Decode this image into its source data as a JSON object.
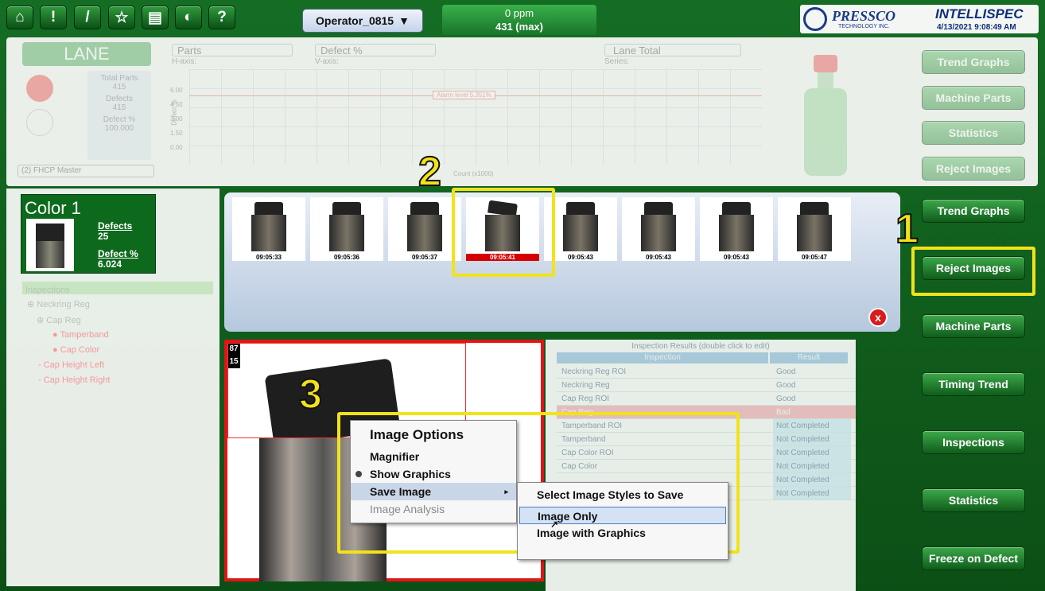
{
  "topbar": {
    "icons": [
      "home-icon",
      "alert-icon",
      "wrench-icon",
      "star-icon",
      "save-icon",
      "globe-icon",
      "help-icon"
    ],
    "home": "⌂",
    "alert": "!",
    "wrench": "/",
    "star": "☆",
    "save": "▤",
    "globe": "◐",
    "help": "?",
    "operator": "Operator_0815",
    "rate": "0 ppm",
    "rate_max": "431 (max)",
    "brand": "PRESSCO",
    "brand_sub": "TECHNOLOGY INC.",
    "product": "INTELLISPEC",
    "datetime": "4/13/2021 9:08:49 AM"
  },
  "lane_panel": {
    "title": "LANE",
    "dropdowns": [
      "Parts",
      "Defect %",
      "Lane Total"
    ],
    "dropdown_captions": [
      "H-axis:",
      "V-axis:",
      "Series:"
    ],
    "stats": [
      {
        "label": "Total Parts",
        "value": "415"
      },
      {
        "label": "Defects",
        "value": "415"
      },
      {
        "label": "Defect %",
        "value": "100.000"
      }
    ],
    "recipe": "(2) FHCP Master",
    "y_ticks": [
      "6.00",
      "4.50",
      "3.00",
      "1.50",
      "0.00"
    ],
    "y_label": "Defect %",
    "x_label": "Count (x1000)",
    "alarm": "Alarm level 5.351%",
    "side_buttons": [
      "Trend Graphs",
      "Machine Parts",
      "Statistics",
      "Reject Images"
    ]
  },
  "color_card": {
    "title": "Color 1",
    "defects_label": "Defects",
    "defects": "25",
    "defect_pct_label": "Defect %",
    "defect_pct": "6.024"
  },
  "tree": {
    "root": "Inspections",
    "items": [
      "⊕ Neckring Reg",
      "⊕ Cap Reg",
      "● Tamperband",
      "● Cap Color",
      "- Cap Height Left",
      "- Cap Height Right"
    ]
  },
  "thumbnails": [
    "09:05:33",
    "09:05:36",
    "09:05:37",
    "09:05:41",
    "09:05:43",
    "09:05:43",
    "09:05:43",
    "09:05:47"
  ],
  "close_icon": "x",
  "image_overlay": {
    "line1": "87",
    "line2": "15"
  },
  "callouts": [
    "1",
    "2",
    "3"
  ],
  "results": {
    "title": "Inspection Results (double click to edit)",
    "headers": [
      "Inspection",
      "Result"
    ],
    "rows": [
      [
        "Neckring Reg ROI",
        "Good"
      ],
      [
        "Neckring Reg",
        "Good"
      ],
      [
        "Cap Reg ROI",
        "Good"
      ],
      [
        "Cap Reg",
        "Bad"
      ],
      [
        "Tamperband ROI",
        "Not Completed"
      ],
      [
        "Tamperband",
        "Not Completed"
      ],
      [
        "Cap Color ROI",
        "Not Completed"
      ],
      [
        "Cap Color",
        "Not Completed"
      ],
      [
        "",
        "Not Completed"
      ],
      [
        "",
        "Not Completed"
      ]
    ]
  },
  "context_menu": {
    "title": "Image Options",
    "items": [
      "Magnifier",
      "Show Graphics",
      "Save Image",
      "Image Analysis"
    ],
    "submenu": [
      "Select Image Styles to Save",
      "Image Only",
      "Image with Graphics"
    ]
  },
  "right_buttons": [
    "Trend Graphs",
    "Reject Images",
    "Machine Parts",
    "Timing Trend",
    "Inspections",
    "Statistics",
    "Freeze on Defect"
  ]
}
